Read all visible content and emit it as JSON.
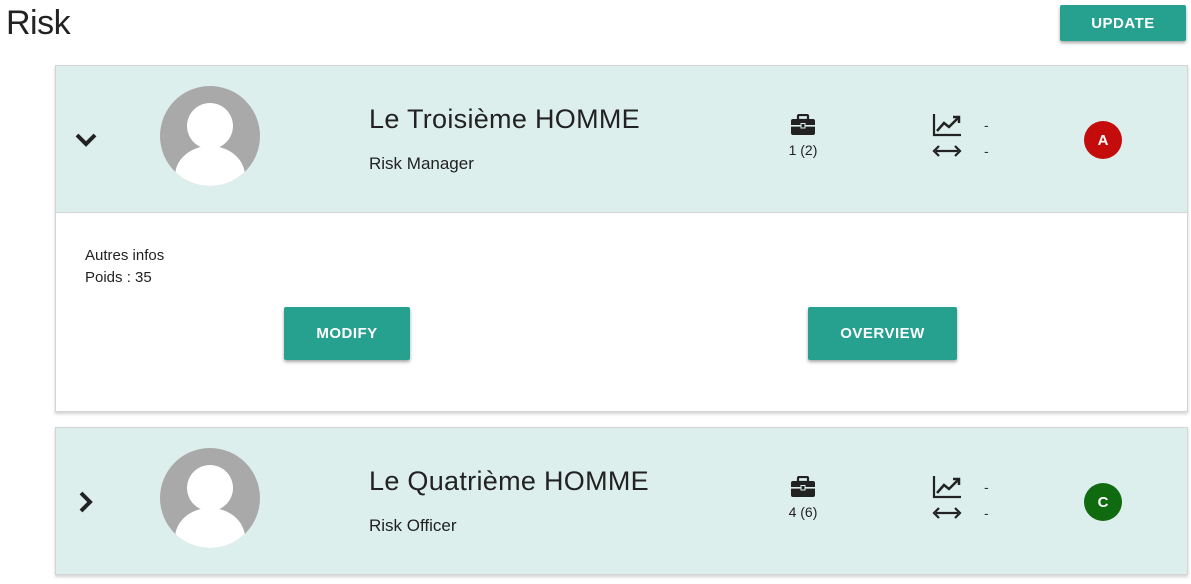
{
  "page": {
    "title": "Risk",
    "update_label": "UPDATE"
  },
  "colors": {
    "accent": "#26a08f",
    "header_bg": "#ddefed",
    "grade_a": "#c40c0c",
    "grade_c": "#106b10"
  },
  "cards": [
    {
      "expanded": true,
      "chevron_icon": "chevron-down-icon",
      "name": "Le Troisième HOMME",
      "role": "Risk Manager",
      "portfolio_count": "1 (2)",
      "trend_value": "-",
      "range_value": "-",
      "grade": "A",
      "details": {
        "other_info": "Autres infos",
        "weight": "Poids : 35",
        "modify_label": "MODIFY",
        "overview_label": "OVERVIEW"
      }
    },
    {
      "expanded": false,
      "chevron_icon": "chevron-right-icon",
      "name": "Le Quatrième HOMME",
      "role": "Risk Officer",
      "portfolio_count": "4 (6)",
      "trend_value": "-",
      "range_value": "-",
      "grade": "C"
    }
  ],
  "icons": {
    "portfolio": "briefcase-icon",
    "trend": "trending-up-icon",
    "range": "double-arrow-icon",
    "avatar": "user-avatar-icon"
  }
}
